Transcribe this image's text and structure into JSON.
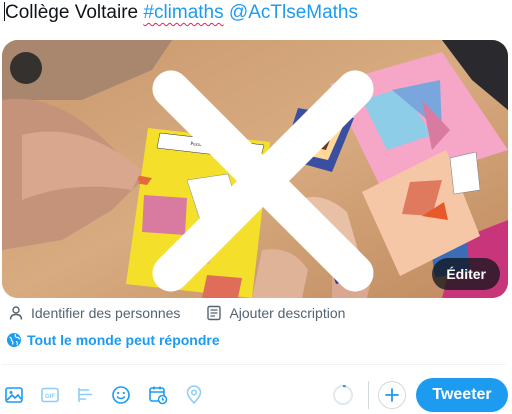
{
  "composer": {
    "text_start": "Collège Voltaire ",
    "hashtag": "#climaths",
    "mention": "@AcTlseMaths"
  },
  "photo": {
    "card_title": "Puzzle d'Al-Nayrizi",
    "edit_label": "Éditer",
    "close_icon": "close-icon"
  },
  "media_actions": {
    "tag_people": "Identifier des personnes",
    "add_description": "Ajouter description"
  },
  "reply_setting": "Tout le monde peut répondre",
  "toolbar": {
    "gif_label": "GIF",
    "icons": [
      "image-icon",
      "gif-icon",
      "poll-icon",
      "emoji-icon",
      "schedule-icon",
      "location-icon"
    ],
    "tweet_label": "Tweeter"
  },
  "colors": {
    "accent": "#1d9bf0",
    "text": "#0f1419",
    "muted": "#536471"
  }
}
